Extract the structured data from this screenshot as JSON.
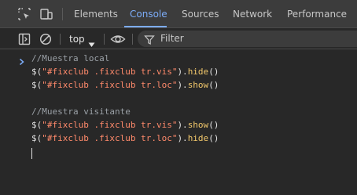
{
  "tabs": [
    {
      "label": "Elements",
      "active": false
    },
    {
      "label": "Console",
      "active": true
    },
    {
      "label": "Sources",
      "active": false
    },
    {
      "label": "Network",
      "active": false
    },
    {
      "label": "Performance",
      "active": false
    }
  ],
  "toolbar": {
    "context": "top",
    "filter_placeholder": "Filter"
  },
  "console": {
    "lines": [
      {
        "type": "comment",
        "text": "//Muestra local"
      },
      {
        "type": "code",
        "prefix": "$(",
        "selector": "\"#fixclub .fixclub tr.vis\"",
        "mid": ").",
        "method": "hide",
        "suffix": "()"
      },
      {
        "type": "code",
        "prefix": "$(",
        "selector": "\"#fixclub .fixclub tr.loc\"",
        "mid": ").",
        "method": "show",
        "suffix": "()"
      },
      {
        "type": "blank",
        "text": ""
      },
      {
        "type": "comment",
        "text": "//Muestra visitante"
      },
      {
        "type": "code",
        "prefix": "$(",
        "selector": "\"#fixclub .fixclub tr.vis\"",
        "mid": ").",
        "method": "show",
        "suffix": "()"
      },
      {
        "type": "code",
        "prefix": "$(",
        "selector": "\"#fixclub .fixclub tr.loc\"",
        "mid": ").",
        "method": "hide",
        "suffix": "()"
      }
    ]
  },
  "colors": {
    "background": "#282828",
    "tabbar_bg": "#3c3c3c",
    "accent": "#7cacf8",
    "comment": "#9aa0a6",
    "string": "#ff8a6b",
    "method": "#f2c86b"
  },
  "icons": {
    "inspect": "inspect-element-icon",
    "device": "device-toolbar-icon",
    "sidebar": "show-sidebar-icon",
    "clear": "clear-console-icon",
    "eye": "live-expression-icon",
    "filter": "filter-icon",
    "prompt": "chevron-right-icon"
  }
}
